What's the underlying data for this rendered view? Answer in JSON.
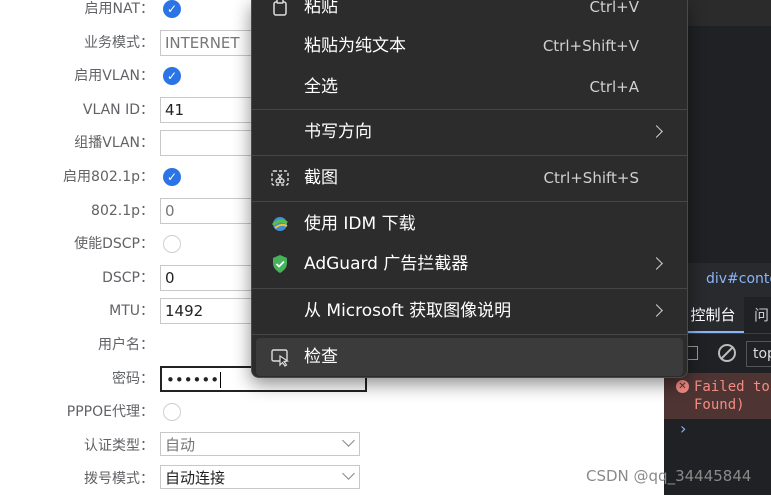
{
  "form": {
    "rows": [
      {
        "label": "启用NAT：",
        "type": "check",
        "checked": true
      },
      {
        "label": "业务模式：",
        "type": "input",
        "value": "INTERNET",
        "disabled": true
      },
      {
        "label": "启用VLAN：",
        "type": "check",
        "checked": true
      },
      {
        "label": "VLAN ID：",
        "type": "input",
        "value": "41"
      },
      {
        "label": "组播VLAN：",
        "type": "input",
        "value": ""
      },
      {
        "label": "启用802.1p：",
        "type": "check",
        "checked": true
      },
      {
        "label": "802.1p：",
        "type": "input",
        "value": "0",
        "disabled": true
      },
      {
        "label": "使能DSCP：",
        "type": "check",
        "checked": false
      },
      {
        "label": "DSCP：",
        "type": "input",
        "value": "0"
      },
      {
        "label": "MTU：",
        "type": "input",
        "value": "1492"
      },
      {
        "label": "用户名：",
        "type": "input",
        "value": "",
        "blurred": true
      },
      {
        "label": "密码：",
        "type": "password",
        "value": "••••••"
      },
      {
        "label": "PPPOE代理：",
        "type": "check",
        "checked": false
      },
      {
        "label": "认证类型：",
        "type": "select",
        "value": "自动",
        "disabled": true
      },
      {
        "label": "拨号模式：",
        "type": "select",
        "value": "自动连接"
      }
    ]
  },
  "menu": {
    "paste": {
      "label": "粘贴",
      "shortcut": "Ctrl+V"
    },
    "paste_plain": {
      "label": "粘贴为纯文本",
      "shortcut": "Ctrl+Shift+V"
    },
    "select_all": {
      "label": "全选",
      "shortcut": "Ctrl+A"
    },
    "writing_direction": {
      "label": "书写方向"
    },
    "screenshot": {
      "label": "截图",
      "shortcut": "Ctrl+Shift+S"
    },
    "idm": {
      "label": "使用 IDM 下载"
    },
    "adguard": {
      "label": "AdGuard 广告拦截器"
    },
    "image_desc": {
      "label": "从 Microsoft 获取图像说明"
    },
    "inspect": {
      "label": "检查"
    }
  },
  "devtools": {
    "breadcrumb": "div#conte",
    "tab_console": "控制台",
    "tab_issues": "问",
    "context": "top",
    "error_text": "Failed to\nFound)",
    "prompt": "›"
  },
  "watermark": "CSDN @qq_34445844",
  "colors": {
    "accent": "#2b74e6",
    "menu_bg": "#2c2c2c",
    "devtools_bg": "#202124",
    "error": "#f28b82"
  }
}
